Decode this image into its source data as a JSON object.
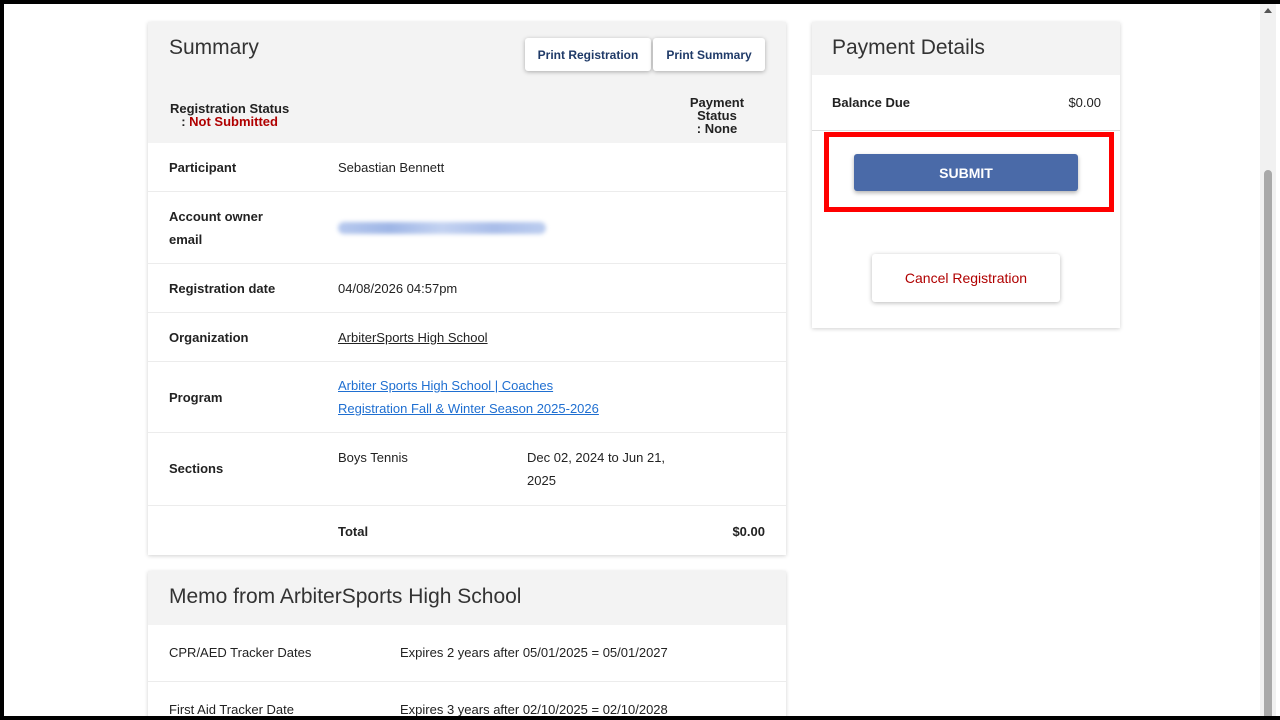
{
  "summary": {
    "title": "Summary",
    "print_registration": "Print Registration",
    "print_summary": "Print Summary",
    "registration_status_label": "Registration Status",
    "registration_status_prefix": ": ",
    "registration_status_value": "Not Submitted",
    "payment_status_line1": "Payment",
    "payment_status_line2": "Status",
    "payment_status_line3": ": None",
    "participant_label": "Participant",
    "participant_value": "Sebastian Bennett",
    "account_email_label_1": "Account owner",
    "account_email_label_2": "email",
    "registration_date_label": "Registration date",
    "registration_date_value": "04/08/2026 04:57pm",
    "organization_label": "Organization",
    "organization_value": "ArbiterSports High School",
    "program_label": "Program",
    "program_value_1": "Arbiter Sports High School | Coaches",
    "program_value_2": "Registration Fall & Winter Season 2025-2026",
    "sections_label": "Sections",
    "section_name": "Boys Tennis",
    "section_dates_1": "Dec 02, 2024 to Jun 21,",
    "section_dates_2": "2025",
    "total_label": "Total",
    "total_value": "$0.00"
  },
  "memo": {
    "title": "Memo from ArbiterSports High School",
    "rows": [
      {
        "key": "CPR/AED Tracker Dates",
        "value": "Expires 2 years after 05/01/2025 = 05/01/2027"
      },
      {
        "key": "First Aid Tracker Date",
        "value": "Expires 3 years after 02/10/2025 = 02/10/2028"
      }
    ]
  },
  "payment": {
    "title": "Payment Details",
    "balance_label": "Balance Due",
    "balance_value": "$0.00",
    "submit_label": "SUBMIT",
    "cancel_label": "Cancel Registration"
  },
  "colors": {
    "accent_red": "#b00000",
    "submit_blue": "#4a6aa8",
    "link_blue": "#1f6fd1",
    "highlight": "#ff0000"
  }
}
